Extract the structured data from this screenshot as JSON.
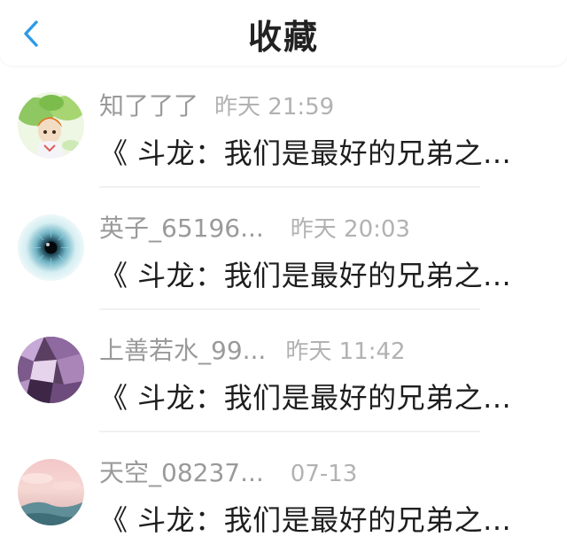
{
  "header": {
    "title": "收藏",
    "back_icon": "chevron-left-icon",
    "accent": "#2d9ae8"
  },
  "items": [
    {
      "name": "知了了了",
      "time": "昨天 21:59",
      "title": "《 斗龙：我们是最好的兄弟之...",
      "avatar": "anime-girl-avatar"
    },
    {
      "name": "英子_65196...",
      "time": "昨天 20:03",
      "title": "《 斗龙：我们是最好的兄弟之...",
      "avatar": "eye-avatar"
    },
    {
      "name": "上善若水_99...",
      "time": "昨天 11:42",
      "title": "《 斗龙：我们是最好的兄弟之...",
      "avatar": "purple-flower-avatar"
    },
    {
      "name": "天空_08237...",
      "time": "07-13",
      "title": "《 斗龙：我们是最好的兄弟之...",
      "avatar": "sunset-sky-avatar"
    }
  ]
}
